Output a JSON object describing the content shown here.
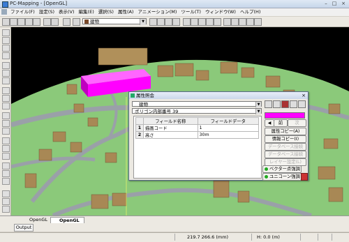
{
  "window": {
    "title": "PC-Mapping - [OpenGL]",
    "minimize": "–",
    "maximize": "□",
    "close": "×"
  },
  "menu": [
    "ファイル(F)",
    "設定(S)",
    "表示(V)",
    "編集(E)",
    "選択(S)",
    "属性(A)",
    "アニメーション(M)",
    "ツール(T)",
    "ウィンドウ(W)",
    "ヘルプ(H)"
  ],
  "toolbar": {
    "layer_value": "建物"
  },
  "tabs": [
    "OpenGL",
    "OpenGL"
  ],
  "output_label": "Output",
  "status": {
    "coords": "219.7 266.6 (mm)",
    "height": "H: 0.0 (m)"
  },
  "dialog": {
    "title": "属性照会",
    "layer_value": "建物",
    "polygon_value": "ポリゴン内部番号 39",
    "columns": [
      "フィールド名称",
      "フィールドデータ"
    ],
    "rows": [
      {
        "num": "1",
        "name": "描画コード",
        "data": "1"
      },
      {
        "num": "2",
        "name": "高さ",
        "data": "30m"
      }
    ],
    "prev_label": "前",
    "next_label": "次",
    "attr_copy_label": "属性コピー(A)",
    "info_copy_label": "情報コピー(I)",
    "disabled1": "データベース接続(D)",
    "disabled2": "データベース接続(B)",
    "disabled3": "レイヤー設定(L)",
    "vector_label": "ベクター点強調",
    "unicorn_label": "ユニコーン強調",
    "swatch_color": "#ff00ff"
  },
  "colors": {
    "ground": "#8bc97a",
    "road": "#9aa0a8",
    "building": "#a88855",
    "highlight": "#ff00ff"
  }
}
